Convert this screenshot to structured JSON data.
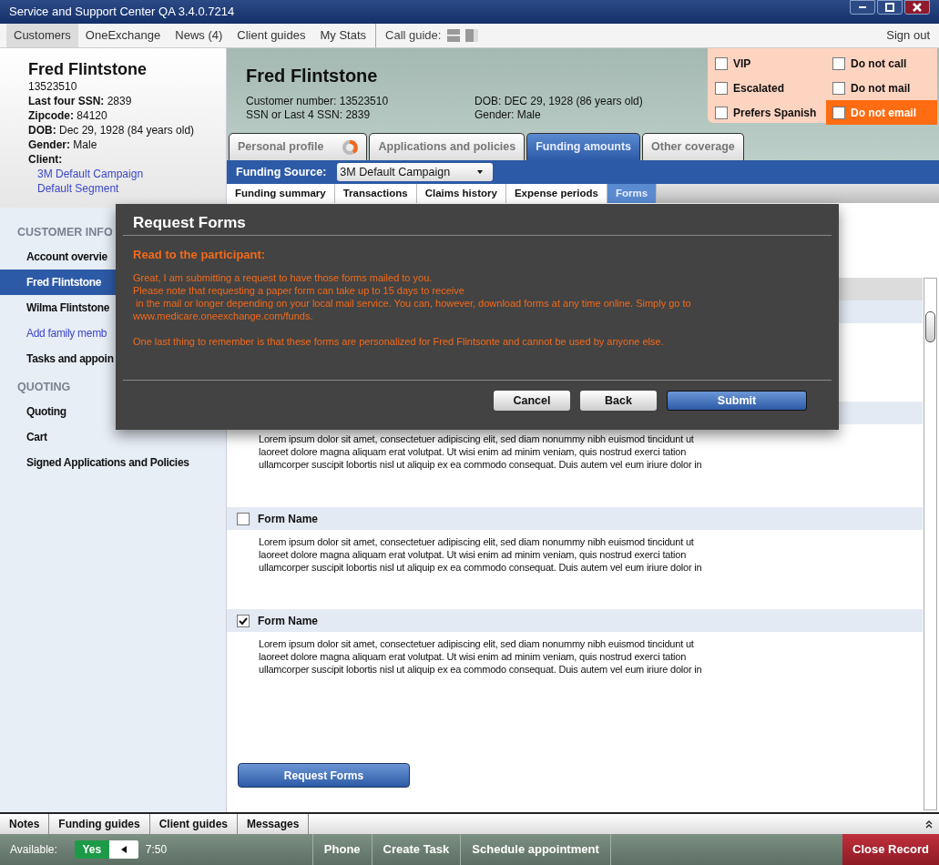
{
  "window": {
    "title": "Service and Support Center QA 3.4.0.7214"
  },
  "nav": {
    "items": [
      {
        "label": "Customers",
        "selected": true
      },
      {
        "label": "OneExchange",
        "selected": false
      },
      {
        "label": "News (4)",
        "selected": false
      },
      {
        "label": "Client guides",
        "selected": false
      },
      {
        "label": "My Stats",
        "selected": false
      }
    ],
    "call_guide": "Call guide:",
    "sign_out": "Sign out"
  },
  "customer_card": {
    "name": "Fred Flintstone",
    "number": "13523510",
    "fields": [
      "**Last four SSN:** 2839",
      "**Zipcode:** 84120",
      "**DOB:** Dec 29, 1928 (84 years old)",
      "**Gender:** Male",
      "**Client:**"
    ],
    "links": [
      "3M Default Campaign",
      "Default Segment"
    ]
  },
  "sidebar": {
    "sections": [
      {
        "title": "CUSTOMER INFO",
        "items": [
          {
            "label": "Account overvie",
            "kind": "item",
            "selected": false
          },
          {
            "label": "Fred Flintstone",
            "kind": "item",
            "selected": true
          },
          {
            "label": "Wilma Flintstone",
            "kind": "item",
            "selected": false
          },
          {
            "label": "Add family memb",
            "kind": "link",
            "selected": false
          },
          {
            "label": "Tasks and appoin",
            "kind": "item",
            "selected": false
          }
        ]
      },
      {
        "title": "QUOTING",
        "items": [
          {
            "label": "Quoting",
            "kind": "item",
            "selected": false
          },
          {
            "label": "Cart",
            "kind": "item",
            "selected": false
          },
          {
            "label": "Signed Applications and Policies",
            "kind": "item",
            "selected": false
          }
        ]
      }
    ]
  },
  "header": {
    "name": "Fred Flintstone",
    "col_1": [
      "Customer number: 13523510",
      "SSN or Last 4 SSN: 2839"
    ],
    "col_2": [
      "DOB: DEC 29, 1928 (86 years old)",
      "Gender: Male"
    ],
    "flags": [
      {
        "label": "VIP",
        "checked": false,
        "highlighted": false
      },
      {
        "label": "Do not call",
        "checked": false,
        "highlighted": false
      },
      {
        "label": "Escalated",
        "checked": false,
        "highlighted": false
      },
      {
        "label": "Do not mail",
        "checked": false,
        "highlighted": false
      },
      {
        "label": "Prefers Spanish",
        "checked": false,
        "highlighted": false
      },
      {
        "label": "Do not email",
        "checked": false,
        "highlighted": true
      }
    ]
  },
  "tabs": [
    {
      "label": "Personal profile",
      "selected": false,
      "kind": "progress"
    },
    {
      "label": "Applications and policies",
      "selected": false,
      "kind": "plain"
    },
    {
      "label": "Funding amounts",
      "selected": true,
      "kind": "plain"
    },
    {
      "label": "Other coverage",
      "selected": false,
      "kind": "plain"
    }
  ],
  "funding": {
    "label": "Funding Source:",
    "value": "3M Default Campaign"
  },
  "subtabs": [
    {
      "label": "Funding summary",
      "selected": false
    },
    {
      "label": "Transactions",
      "selected": false
    },
    {
      "label": "Claims history",
      "selected": false
    },
    {
      "label": "Expense periods",
      "selected": false
    },
    {
      "label": "Forms",
      "selected": true
    }
  ],
  "partial_form": {
    "body": "Lorem ipsum dolor sit amet, consectetuer adipiscing elit, sed diam nonummy nibh euismod tincidunt ut\nlaoreet dolore magna aliquam erat volutpat. Ut wisi enim ad minim veniam, quis nostrud exerci tation\nullamcorper suscipit lobortis nisl ut aliquip ex ea commodo consequat. Duis autem vel eum iriure dolor in"
  },
  "forms": [
    {
      "name": "Form Name",
      "checked": false,
      "body": "Lorem ipsum dolor sit amet, consectetuer adipiscing elit, sed diam nonummy nibh euismod tincidunt ut\nlaoreet dolore magna aliquam erat volutpat. Ut wisi enim ad minim veniam, quis nostrud exerci tation\nullamcorper suscipit lobortis nisl ut aliquip ex ea commodo consequat. Duis autem vel eum iriure dolor in"
    },
    {
      "name": "Form Name",
      "checked": true,
      "body": "Lorem ipsum dolor sit amet, consectetuer adipiscing elit, sed diam nonummy nibh euismod tincidunt ut\nlaoreet dolore magna aliquam erat volutpat. Ut wisi enim ad minim veniam, quis nostrud exerci tation\nullamcorper suscipit lobortis nisl ut aliquip ex ea commodo consequat. Duis autem vel eum iriure dolor in"
    }
  ],
  "request_button": "Request Forms",
  "dialog": {
    "title": "Request Forms",
    "heading": "Read to the participant:",
    "paragraphs": [
      "Great, I am submitting a request to have those forms mailed to you.\nPlease note that requesting a paper form can take up to 15 days to receive\n in the mail or longer depending on your local mail service. You can, however, download forms at any time online. Simply go to\nwww.medicare.oneexchange.com/funds.",
      "One last thing to remember is that these forms are personalized for Fred Flintsonte and cannot be used by anyone else."
    ],
    "buttons": [
      {
        "label": "Cancel",
        "kind": "secondary"
      },
      {
        "label": "Back",
        "kind": "secondary"
      },
      {
        "label": "Submit",
        "kind": "primary"
      }
    ]
  },
  "bottom_tabs": [
    "Notes",
    "Funding guides",
    "Client guides",
    "Messages"
  ],
  "status_bar": {
    "available_label": "Available:",
    "toggle": {
      "label": "Yes",
      "on": true
    },
    "time": "7:50",
    "actions": [
      "Phone",
      "Create Task",
      "Schedule appointment"
    ],
    "close": "Close Record"
  }
}
